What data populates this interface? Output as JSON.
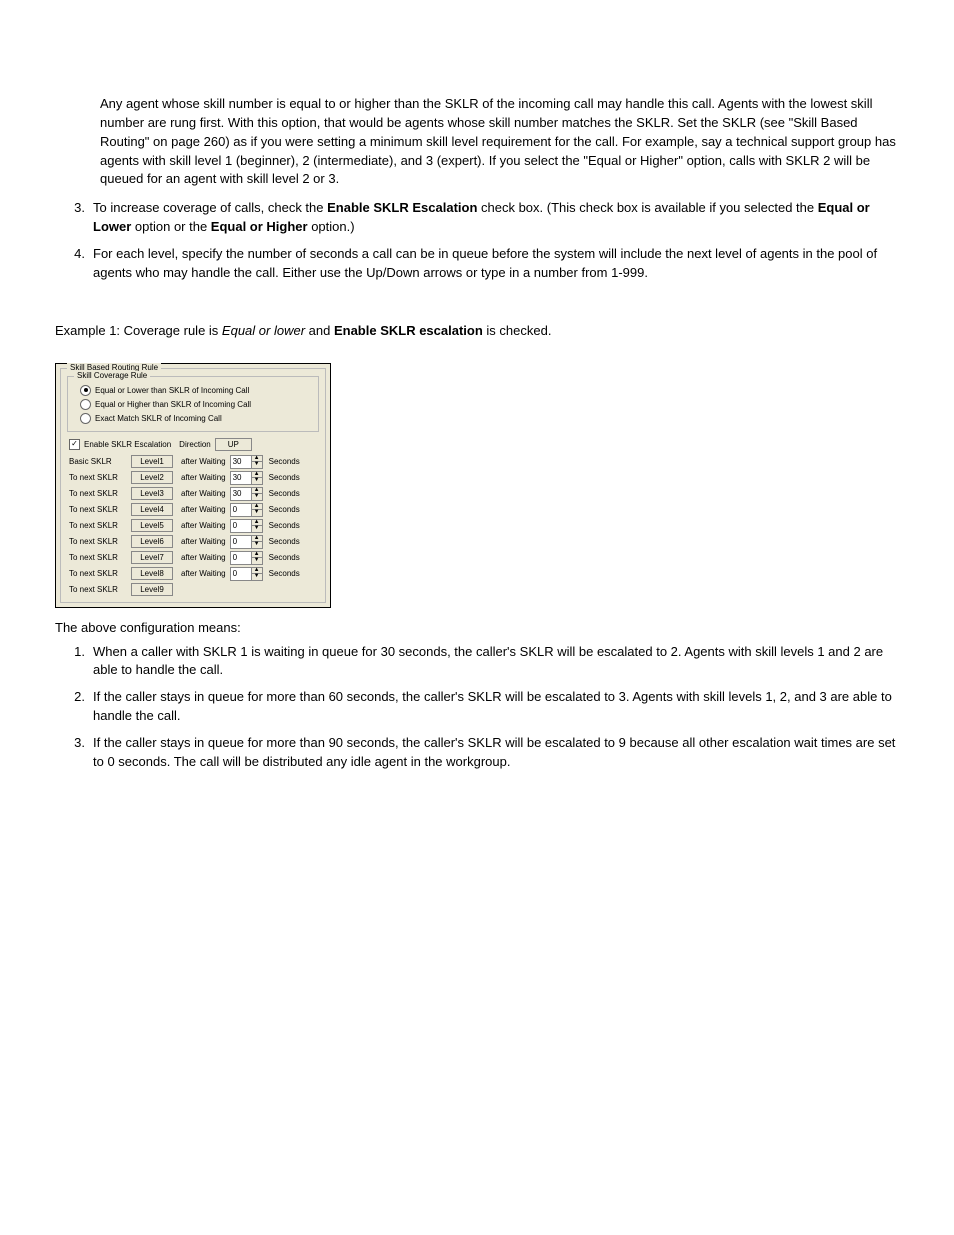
{
  "intro_paragraph": "Any agent whose skill number is equal to or higher than the SKLR of the incoming call may handle this call. Agents with the lowest skill number are rung first. With this option, that would be agents whose skill number matches the SKLR. Set the SKLR (see \"Skill Based Routing\" on page 260) as if you were setting a minimum skill level requirement for the call. For example, say a technical support group has agents with skill level 1 (beginner), 2 (intermediate), and 3 (expert). If you select the \"Equal or Higher\" option, calls with SKLR 2 will be queued for an agent with skill level 2 or 3.",
  "step3_num": "3.",
  "step3_a": "To increase coverage of calls, check the ",
  "step3_b_bold": "Enable SKLR Escalation",
  "step3_c": " check box. (This check box is available if you selected the ",
  "step3_d_bold": "Equal or Lower",
  "step3_e": " option or the ",
  "step3_f_bold": "Equal or Higher",
  "step3_g": " option.)",
  "step4_num": "4.",
  "step4_text": "For each level, specify the number of seconds a call can be in queue before the system will include the next level of agents in the pool of agents who may handle the call. Either use the Up/Down arrows or type in a number from 1-999.",
  "example_a": "Example 1: Coverage rule is ",
  "example_b_italic": "Equal or lower",
  "example_c": " and ",
  "example_d_bold": "Enable SKLR escalation",
  "example_e": " is checked.",
  "panel": {
    "outer_legend": "Skill Based Routing Rule",
    "inner_legend": "Skill Coverage Rule",
    "radios": [
      {
        "label": "Equal or Lower than SKLR of Incoming Call",
        "on": true
      },
      {
        "label": "Equal or Higher than SKLR of Incoming Call",
        "on": false
      },
      {
        "label": "Exact Match SKLR of Incoming Call",
        "on": false
      }
    ],
    "enable_chk": {
      "on": true,
      "label": "Enable SKLR Escalation"
    },
    "direction_label": "Direction",
    "direction_value": "UP",
    "first_label": "Basic SKLR",
    "next_label": "To next SKLR",
    "after_label": "after Waiting",
    "seconds_label": "Seconds",
    "levels": [
      {
        "btn": "Level1",
        "val": "30"
      },
      {
        "btn": "Level2",
        "val": "30"
      },
      {
        "btn": "Level3",
        "val": "30"
      },
      {
        "btn": "Level4",
        "val": "0"
      },
      {
        "btn": "Level5",
        "val": "0"
      },
      {
        "btn": "Level6",
        "val": "0"
      },
      {
        "btn": "Level7",
        "val": "0"
      },
      {
        "btn": "Level8",
        "val": "0"
      },
      {
        "btn": "Level9"
      }
    ]
  },
  "explain_heading": "The above configuration means:",
  "explain_items": [
    {
      "num": "1.",
      "text": "When a caller with SKLR 1 is waiting in queue for 30 seconds, the caller's SKLR will be escalated to 2. Agents with skill levels 1 and 2 are able to handle the call."
    },
    {
      "num": "2.",
      "text": "If the caller stays in queue for more than 60 seconds, the caller's SKLR will be escalated to 3. Agents with skill levels 1, 2, and 3 are able to handle the call."
    },
    {
      "num": "3.",
      "text": "If the caller stays in queue for more than 90 seconds, the caller's SKLR will be escalated to 9 because all other escalation wait times are set to 0 seconds. The call will be distributed any idle agent in the work­group."
    }
  ]
}
